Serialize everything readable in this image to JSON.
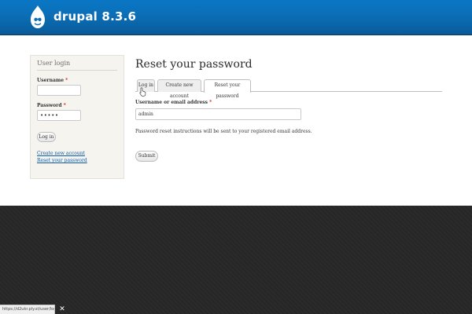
{
  "header": {
    "site_name": "drupal 8.3.6",
    "logo_icon": "drupal-drop-icon",
    "bg_color": "#0b6fb8"
  },
  "sidebar": {
    "title": "User login",
    "username_label": "Username",
    "username_value": "",
    "password_label": "Password",
    "password_value": "•••••",
    "login_button_label": "Log in",
    "create_account_link": "Create new account",
    "reset_password_link": "Reset your password",
    "required_marker": "*"
  },
  "content": {
    "page_title": "Reset your password",
    "tabs": [
      {
        "label": "Log in",
        "active": false
      },
      {
        "label": "Create new account",
        "active": false
      },
      {
        "label": "Reset your password",
        "active": true
      }
    ],
    "username_label": "Username or email address",
    "required_marker": "*",
    "username_value": "admin",
    "help_text": "Password reset instructions will be sent to your registered email address.",
    "submit_label": "Submit",
    "cursor_icon": "hand-pointer-icon"
  },
  "status_bar": {
    "url": "https://d2ukr.ply.st/user/login",
    "close_icon": "close-icon"
  },
  "colors": {
    "link": "#0b58a6",
    "required": "#e0241c",
    "footer_bg": "#262626"
  }
}
